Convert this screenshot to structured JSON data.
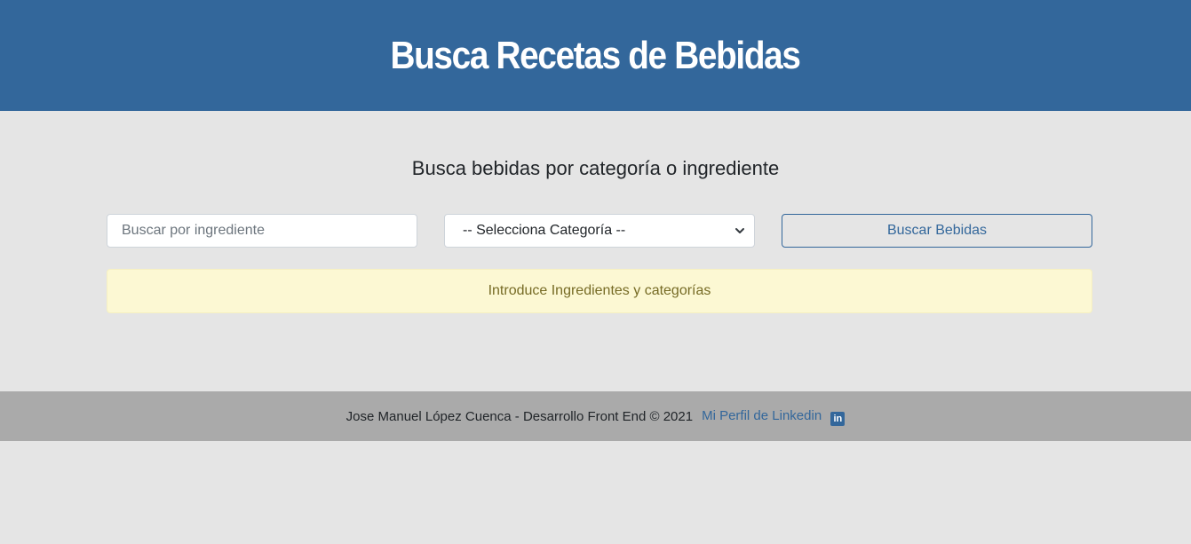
{
  "header": {
    "title": "Busca Recetas de Bebidas"
  },
  "main": {
    "subtitle": "Busca bebidas por categoría o ingrediente",
    "ingredient_input": {
      "value": "",
      "placeholder": "Buscar por ingrediente"
    },
    "category_select": {
      "selected": "-- Selecciona Categoría --"
    },
    "search_button": "Buscar Bebidas",
    "alert": "Introduce Ingredientes y categorías"
  },
  "footer": {
    "credit": "Jose Manuel López Cuenca - Desarrollo Front End © 2021",
    "link_text": "Mi Perfil de Linkedin",
    "link_icon": "linkedin-icon",
    "link_icon_glyph": "in"
  },
  "colors": {
    "primary": "#33679b",
    "background": "#e5e5e5",
    "footer_bg": "#aaaaaa",
    "alert_bg": "#fcf8d3",
    "alert_text": "#766b25"
  }
}
